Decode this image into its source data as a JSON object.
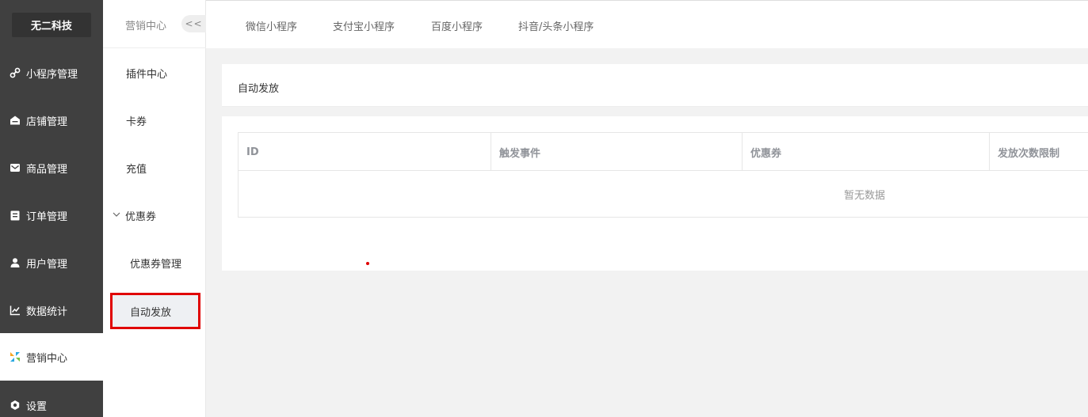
{
  "brand": "无二科技",
  "sidebar": {
    "items": [
      {
        "label": "小程序管理",
        "icon": "link-icon"
      },
      {
        "label": "店铺管理",
        "icon": "store-icon"
      },
      {
        "label": "商品管理",
        "icon": "envelope-icon"
      },
      {
        "label": "订单管理",
        "icon": "clipboard-icon"
      },
      {
        "label": "用户管理",
        "icon": "user-icon"
      },
      {
        "label": "数据统计",
        "icon": "chart-icon"
      },
      {
        "label": "营销中心",
        "icon": "marketing-icon"
      },
      {
        "label": "设置",
        "icon": "gear-icon"
      }
    ]
  },
  "submenu": {
    "title": "营销中心",
    "collapse_label": "<<",
    "items": {
      "plugins": "插件中心",
      "cards": "卡券",
      "recharge": "充值",
      "coupon_group": "优惠券",
      "coupon_manage": "优惠券管理",
      "auto_issue": "自动发放"
    }
  },
  "tabs": [
    "微信小程序",
    "支付宝小程序",
    "百度小程序",
    "抖音/头条小程序"
  ],
  "card": {
    "title": "自动发放"
  },
  "table": {
    "columns": [
      "ID",
      "触发事件",
      "优惠券",
      "发放次数限制"
    ],
    "empty_text": "暂无数据"
  },
  "colors": {
    "sidebar_bg": "#404040",
    "highlight": "#e00000"
  }
}
